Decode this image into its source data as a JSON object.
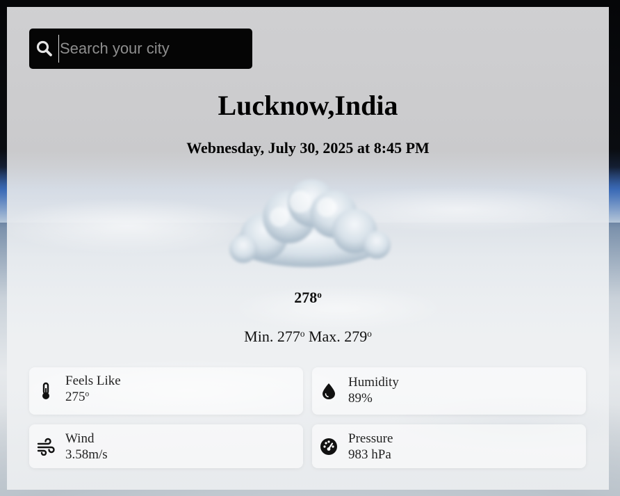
{
  "search": {
    "placeholder": "Search your city",
    "value": ""
  },
  "location": {
    "city": "Lucknow,India"
  },
  "datetime": "Webnesday, July 30, 2025 at 8:45 PM",
  "weather": {
    "icon": "cloud-icon",
    "temperature": "278",
    "degree_symbol": "o",
    "min_label": "Min.",
    "min_value": "277",
    "max_label": "Max.",
    "max_value": "279"
  },
  "stats": {
    "feels_like": {
      "label": "Feels Like",
      "value": "275",
      "icon": "thermometer-icon"
    },
    "humidity": {
      "label": "Humidity",
      "value": "89%",
      "icon": "water-drop-icon"
    },
    "wind": {
      "label": "Wind",
      "value": "3.58m/s",
      "icon": "wind-icon"
    },
    "pressure": {
      "label": "Pressure",
      "value": "983 hPa",
      "icon": "gauge-icon"
    }
  },
  "colors": {
    "search_bg": "#050505",
    "placeholder": "#8e8e8e",
    "text": "#000000"
  }
}
